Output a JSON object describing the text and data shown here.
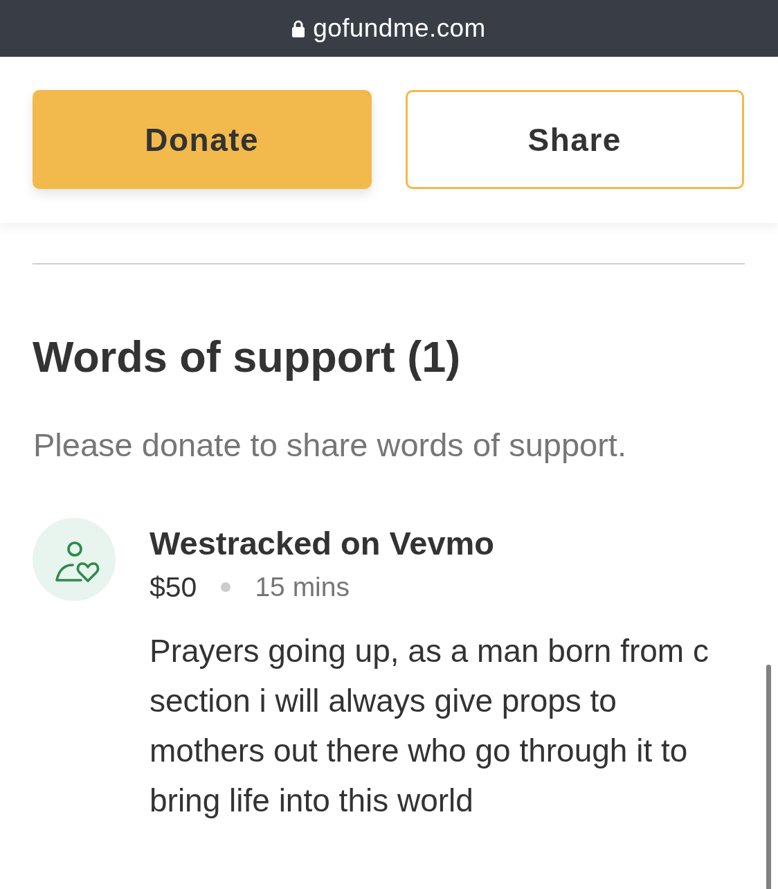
{
  "browser_bar": {
    "secure": true,
    "url": "gofundme.com"
  },
  "action_buttons": [
    {
      "label": "Donate",
      "kind": "primary"
    },
    {
      "label": "Share",
      "kind": "secondary"
    }
  ],
  "words_of_support": {
    "title": "Words of support (1)",
    "notice": "Please donate to share words of support.",
    "comments": [
      {
        "name": "Westracked on Vevmo",
        "amount": "$50",
        "time": "15 mins",
        "message": "Prayers going up, as a man born from c section i will always give props to mothers out there who go through it to bring life into this world"
      }
    ]
  }
}
